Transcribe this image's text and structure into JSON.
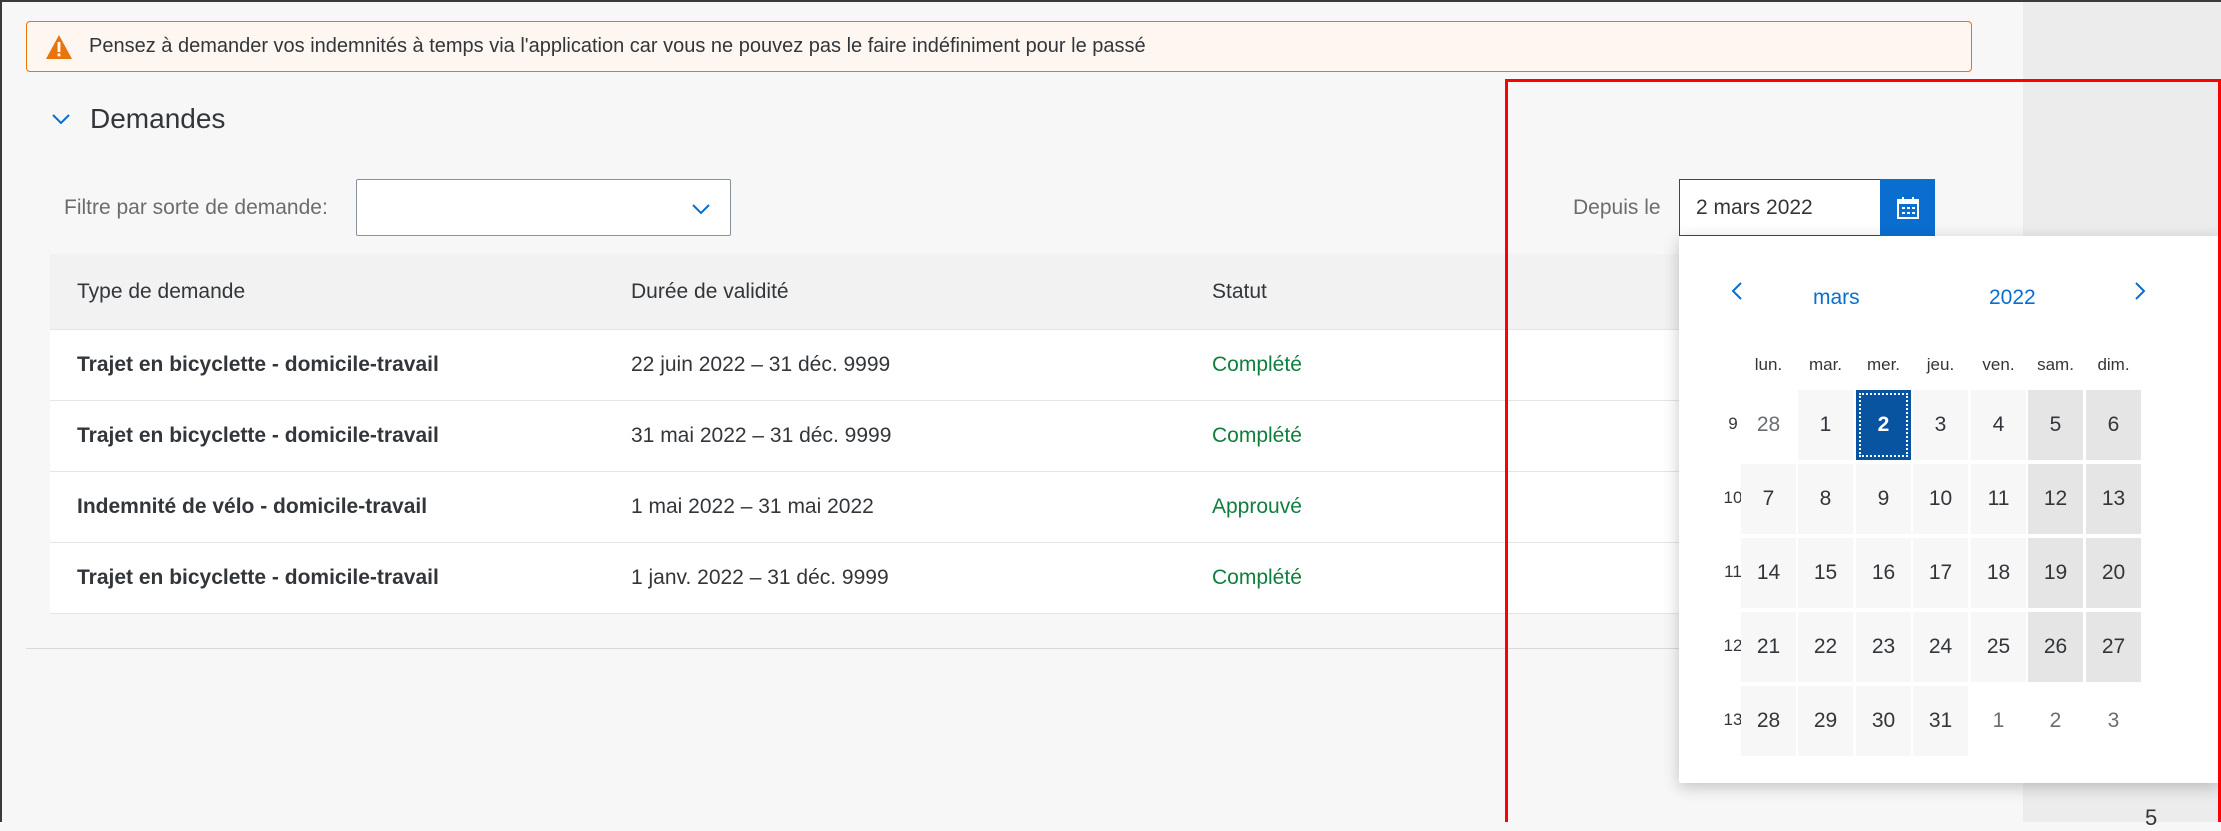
{
  "warning": {
    "text": "Pensez à demander vos indemnités à temps via l'application car vous ne pouvez pas le faire indéfiniment pour le passé",
    "icon": "warning-triangle-icon",
    "color": "#e9730c"
  },
  "section": {
    "title": "Demandes"
  },
  "filter": {
    "label": "Filtre par sorte de demande:",
    "value": ""
  },
  "date_filter": {
    "label": "Depuis le",
    "value": "2 mars 2022"
  },
  "table": {
    "columns": [
      "Type de demande",
      "Durée de validité",
      "Statut"
    ],
    "rows": [
      {
        "type": "Trajet en bicyclette - domicile-travail",
        "duration": "22 juin 2022 – 31 déc. 9999",
        "status": "Complété"
      },
      {
        "type": "Trajet en bicyclette - domicile-travail",
        "duration": "31 mai 2022 – 31 déc. 9999",
        "status": "Complété"
      },
      {
        "type": "Indemnité de vélo - domicile-travail",
        "duration": "1 mai 2022 – 31 mai 2022",
        "status": "Approuvé"
      },
      {
        "type": "Trajet en bicyclette - domicile-travail",
        "duration": "1 janv. 2022 – 31 déc. 9999",
        "status": "Complété"
      }
    ]
  },
  "calendar": {
    "month": "mars",
    "year": "2022",
    "weekdays": [
      "lun.",
      "mar.",
      "mer.",
      "jeu.",
      "ven.",
      "sam.",
      "dim."
    ],
    "weeks": [
      {
        "num": "9",
        "days": [
          {
            "d": "28",
            "other": true
          },
          {
            "d": "1"
          },
          {
            "d": "2",
            "selected": true
          },
          {
            "d": "3"
          },
          {
            "d": "4"
          },
          {
            "d": "5"
          },
          {
            "d": "6"
          }
        ]
      },
      {
        "num": "10",
        "days": [
          {
            "d": "7"
          },
          {
            "d": "8"
          },
          {
            "d": "9"
          },
          {
            "d": "10"
          },
          {
            "d": "11"
          },
          {
            "d": "12"
          },
          {
            "d": "13"
          }
        ]
      },
      {
        "num": "11",
        "days": [
          {
            "d": "14"
          },
          {
            "d": "15"
          },
          {
            "d": "16"
          },
          {
            "d": "17"
          },
          {
            "d": "18"
          },
          {
            "d": "19"
          },
          {
            "d": "20"
          }
        ]
      },
      {
        "num": "12",
        "days": [
          {
            "d": "21"
          },
          {
            "d": "22"
          },
          {
            "d": "23"
          },
          {
            "d": "24"
          },
          {
            "d": "25"
          },
          {
            "d": "26"
          },
          {
            "d": "27"
          }
        ]
      },
      {
        "num": "13",
        "days": [
          {
            "d": "28"
          },
          {
            "d": "29"
          },
          {
            "d": "30"
          },
          {
            "d": "31"
          },
          {
            "d": "1",
            "other": true
          },
          {
            "d": "2",
            "other": true
          },
          {
            "d": "3",
            "other": true
          }
        ]
      }
    ],
    "selected_color": "#0854a0"
  },
  "corner_mark": "5",
  "colors": {
    "accent": "#0a6ed1",
    "success": "#107e3e",
    "highlight_box": "#ff0000"
  }
}
